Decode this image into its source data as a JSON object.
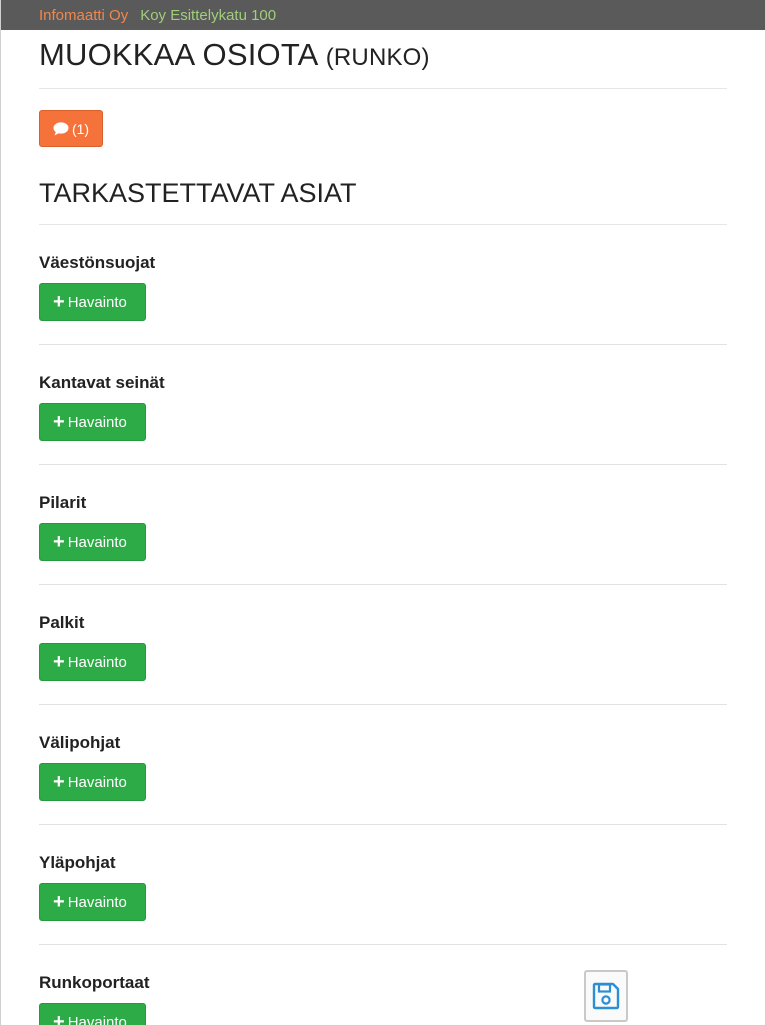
{
  "topbar": {
    "company": "Infomaatti Oy",
    "building": "Koy Esittelykatu 100"
  },
  "page": {
    "title": "MUOKKAA OSIOTA",
    "subtitle": "(RUNKO)"
  },
  "comments": {
    "label": "(1)",
    "icon": "comment-icon",
    "color": "#f5733a"
  },
  "section": {
    "title": "TARKASTETTAVAT ASIAT"
  },
  "items": [
    {
      "label": "Väestönsuojat",
      "button": "Havainto"
    },
    {
      "label": "Kantavat seinät",
      "button": "Havainto"
    },
    {
      "label": "Pilarit",
      "button": "Havainto"
    },
    {
      "label": "Palkit",
      "button": "Havainto"
    },
    {
      "label": "Välipohjat",
      "button": "Havainto"
    },
    {
      "label": "Yläpohjat",
      "button": "Havainto"
    },
    {
      "label": "Runkoportaat",
      "button": "Havainto"
    }
  ],
  "colors": {
    "add_button": "#2cab47",
    "topbar": "#5a5a5a",
    "save_icon": "#2a8fd4"
  },
  "save": {
    "icon": "floppy-disk-icon"
  }
}
